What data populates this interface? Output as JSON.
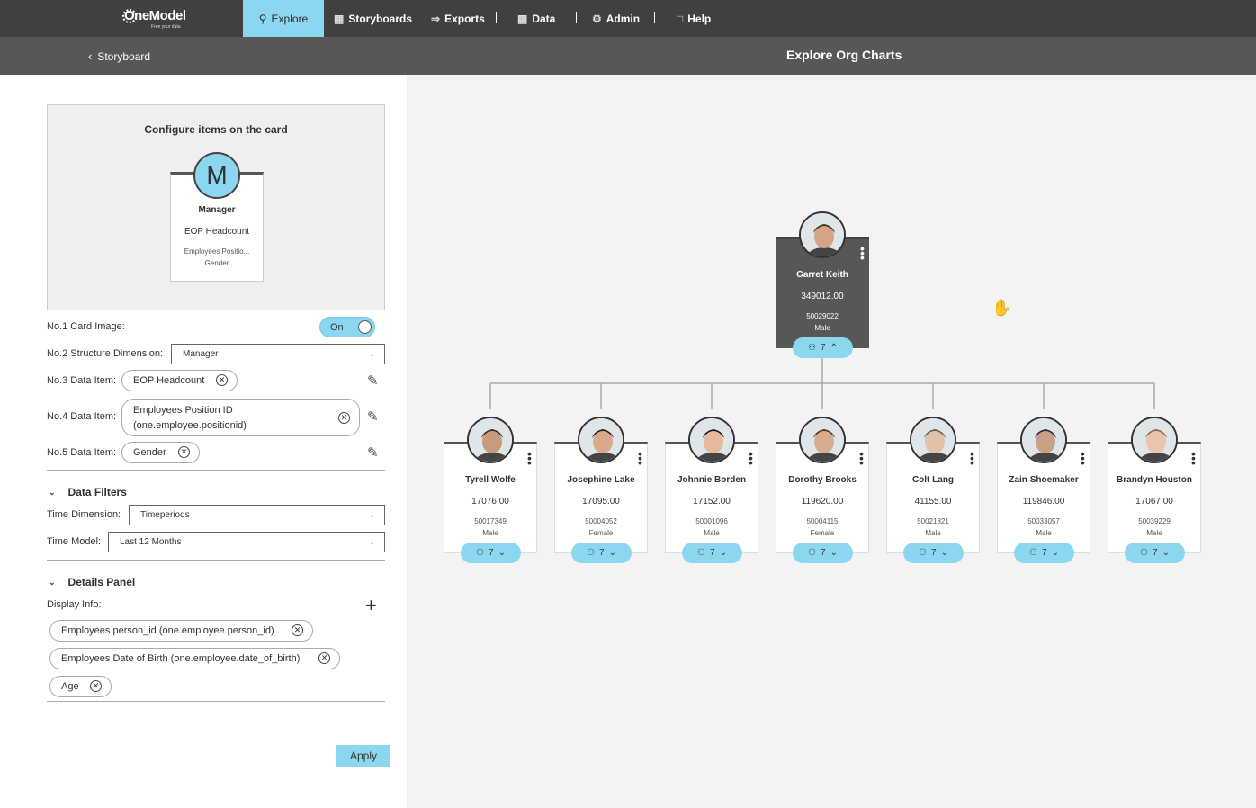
{
  "nav": {
    "logo_name": "OneModel",
    "logo_tagline": "Free your data",
    "items": [
      {
        "label": "Explore",
        "icon": "compass-icon"
      },
      {
        "label": "Storyboards",
        "icon": "storyboard-icon"
      },
      {
        "label": "Exports",
        "icon": "export-icon"
      },
      {
        "label": "Data",
        "icon": "data-icon"
      },
      {
        "label": "Admin",
        "icon": "gear-icon"
      },
      {
        "label": "Help",
        "icon": "help-icon"
      }
    ],
    "active": "Explore",
    "accent_color": "#8bd7f0"
  },
  "subheader": {
    "back_label": "Storyboard",
    "title": "Explore Org Charts"
  },
  "config": {
    "preview_title": "Configure items on the card",
    "preview_card": {
      "initial": "M",
      "line1": "Manager",
      "line2": "EOP Headcount",
      "line3": "Employees Positio...",
      "line4": "Gender"
    },
    "card_image": {
      "label": "No.1 Card Image:",
      "state": "On"
    },
    "structure_dimension": {
      "label": "No.2 Structure Dimension:",
      "value": "Manager"
    },
    "data_item_3": {
      "label": "No.3 Data Item:",
      "value": "EOP Headcount"
    },
    "data_item_4": {
      "label": "No.4 Data Item:",
      "value": "Employees Position ID (one.employee.positionid)"
    },
    "data_item_5": {
      "label": "No.5 Data Item:",
      "value": "Gender"
    }
  },
  "data_filters": {
    "heading": "Data Filters",
    "time_dimension": {
      "label": "Time Dimension:",
      "value": "Timeperiods"
    },
    "time_model": {
      "label": "Time Model:",
      "value": "Last 12 Months"
    }
  },
  "details_panel": {
    "heading": "Details Panel",
    "display_info_label": "Display Info:",
    "items": [
      "Employees person_id (one.employee.person_id)",
      "Employees Date of Birth (one.employee.date_of_birth)",
      "Age"
    ]
  },
  "apply_label": "Apply",
  "org_chart": {
    "manager": {
      "name": "Garret Keith",
      "value": "349012.00",
      "position_id": "50029022",
      "gender": "Male",
      "reports": "7"
    },
    "reports": [
      {
        "name": "Tyrell Wolfe",
        "value": "17076.00",
        "position_id": "50017349",
        "gender": "Male",
        "reports": "7"
      },
      {
        "name": "Josephine Lake",
        "value": "17095.00",
        "position_id": "50004052",
        "gender": "Female",
        "reports": "7"
      },
      {
        "name": "Johnnie Borden",
        "value": "17152.00",
        "position_id": "50001096",
        "gender": "Male",
        "reports": "7"
      },
      {
        "name": "Dorothy Brooks",
        "value": "119620.00",
        "position_id": "50004115",
        "gender": "Female",
        "reports": "7"
      },
      {
        "name": "Colt Lang",
        "value": "41155.00",
        "position_id": "50021821",
        "gender": "Male",
        "reports": "7"
      },
      {
        "name": "Zain Shoemaker",
        "value": "119846.00",
        "position_id": "50033057",
        "gender": "Male",
        "reports": "7"
      },
      {
        "name": "Brandyn Houston",
        "value": "17067.00",
        "position_id": "50039229",
        "gender": "Male",
        "reports": "7"
      }
    ]
  }
}
